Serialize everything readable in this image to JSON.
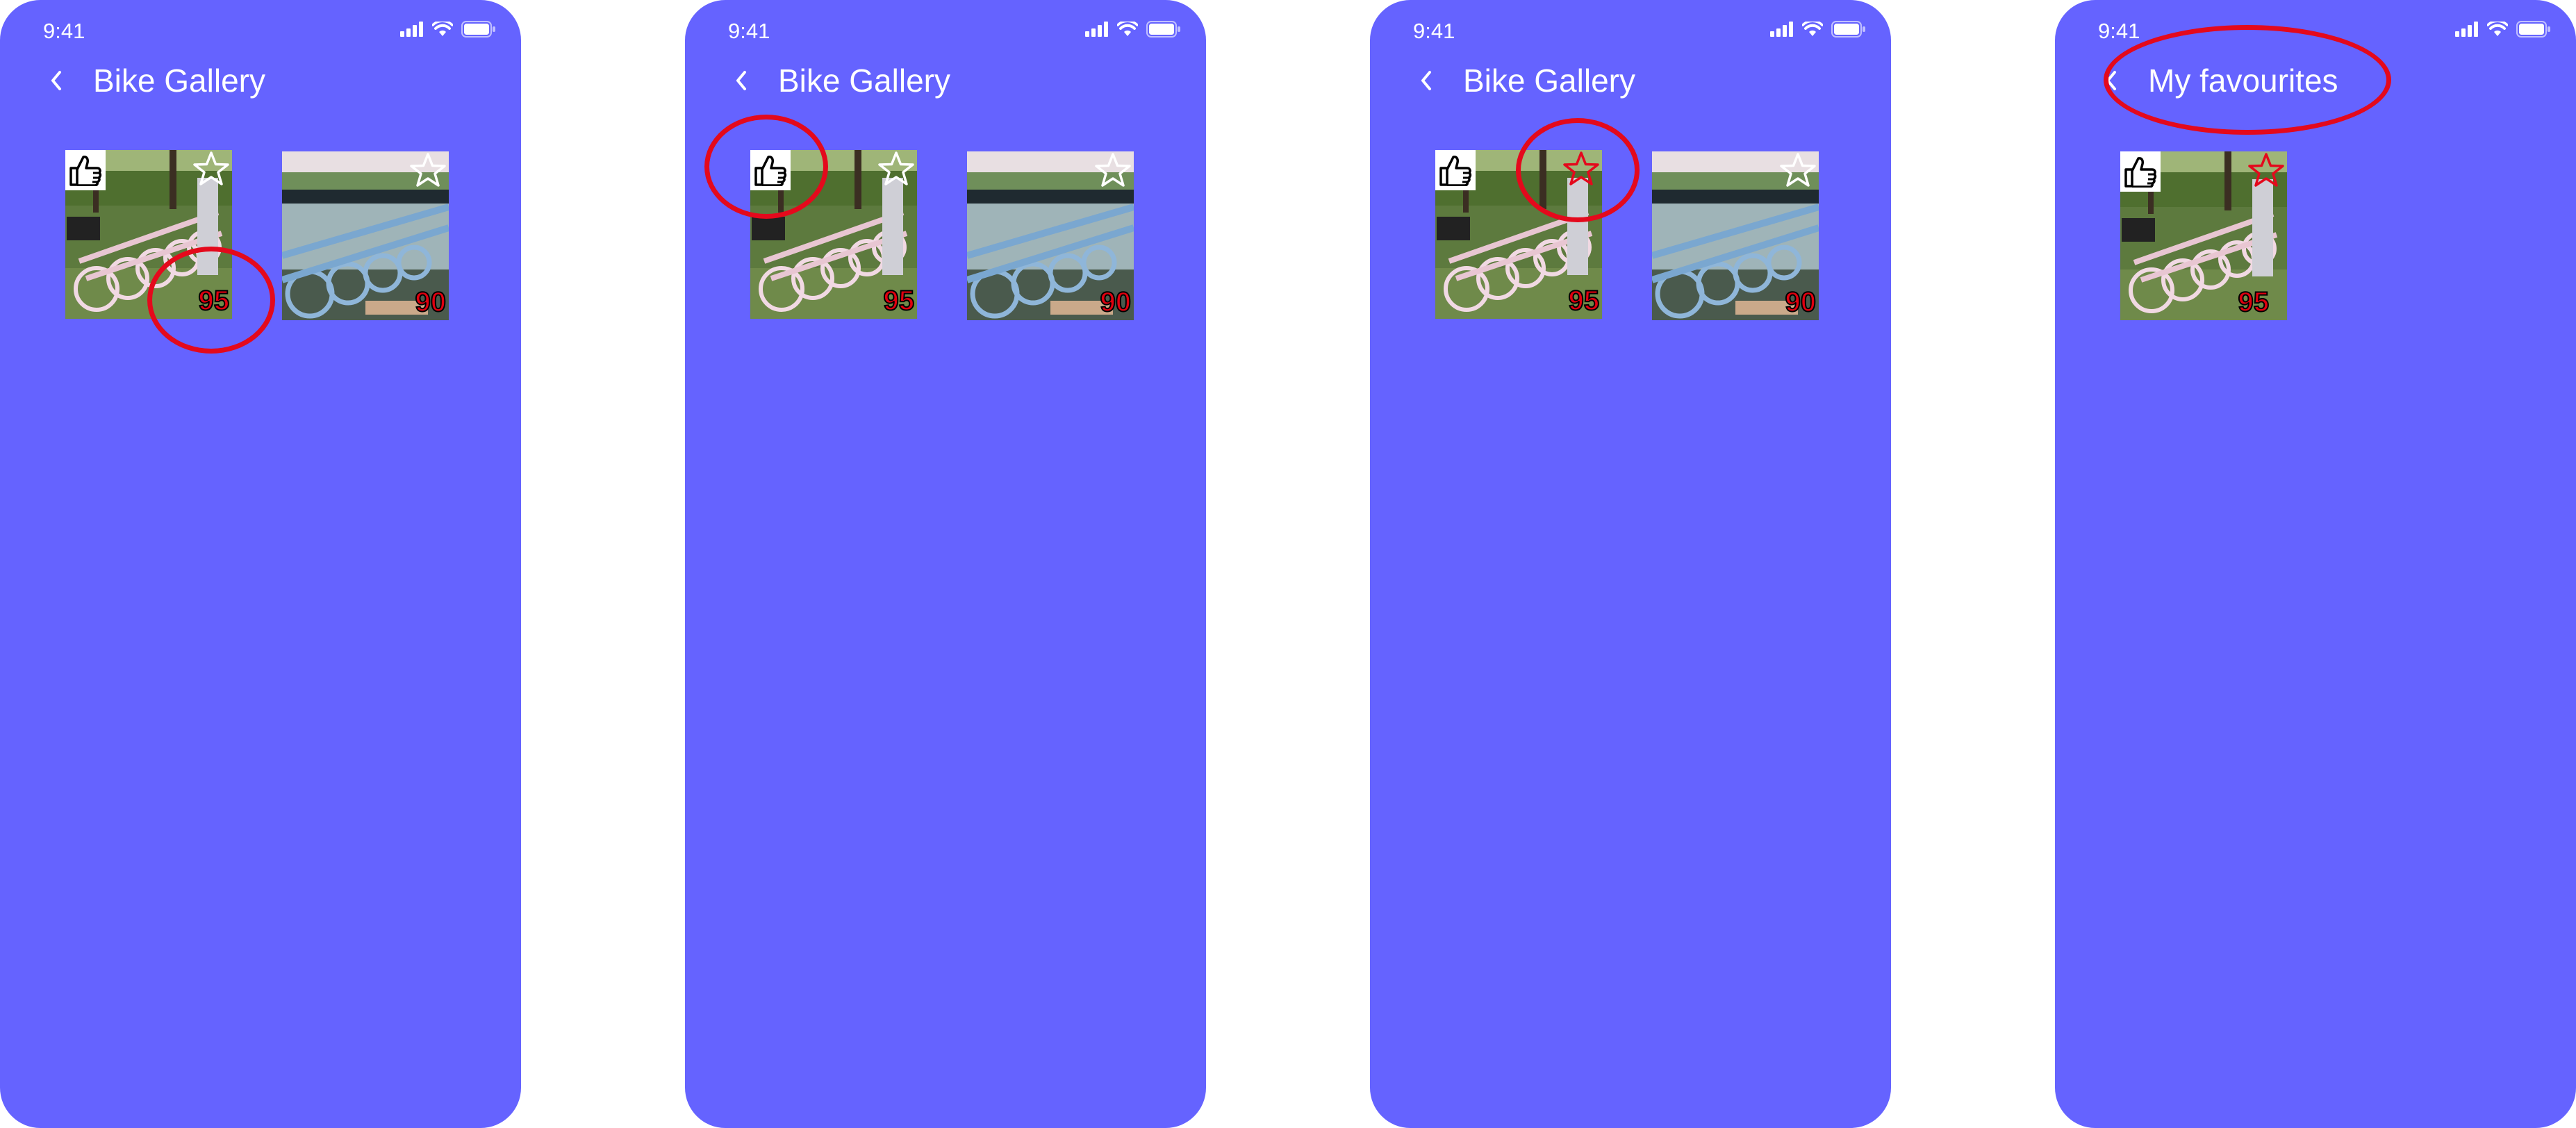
{
  "screens": [
    {
      "time": "9:41",
      "title": "Bike Gallery",
      "items": [
        {
          "photo": "pink-bikes",
          "score": "95",
          "favourite": false
        },
        {
          "photo": "blue-bikes",
          "score": "90",
          "favourite": false
        }
      ],
      "highlight": "score"
    },
    {
      "time": "9:41",
      "title": "Bike Gallery",
      "items": [
        {
          "photo": "pink-bikes",
          "score": "95",
          "favourite": false
        },
        {
          "photo": "blue-bikes",
          "score": "90",
          "favourite": false
        }
      ],
      "highlight": "like-icon"
    },
    {
      "time": "9:41",
      "title": "Bike Gallery",
      "items": [
        {
          "photo": "pink-bikes",
          "score": "95",
          "favourite": true
        },
        {
          "photo": "blue-bikes",
          "score": "90",
          "favourite": false
        }
      ],
      "highlight": "star-icon"
    },
    {
      "time": "9:41",
      "title": "My favourites",
      "items": [
        {
          "photo": "pink-bikes",
          "score": "95",
          "favourite": true
        }
      ],
      "highlight": "title"
    }
  ],
  "colors": {
    "screen_background": "#6563ff",
    "annotation_red": "#e4091c",
    "favourite_star": "#e4091c",
    "score_text": "#e0000f"
  },
  "icons": {
    "back": "chevron-left-icon",
    "like": "thumbs-up-icon",
    "favourite": "star-icon",
    "signal": "cellular-signal-icon",
    "wifi": "wifi-icon",
    "battery": "battery-icon"
  }
}
